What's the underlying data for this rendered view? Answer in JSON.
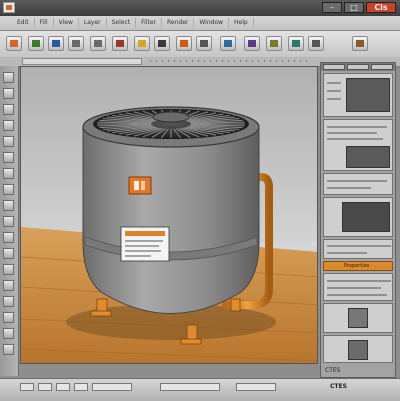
{
  "window": {
    "title": "",
    "close_label": "Cls",
    "min_label": "–",
    "max_label": "□"
  },
  "menu": {
    "items": [
      "Edit",
      "Fill",
      "View",
      "Layer",
      "Select",
      "Filter",
      "Render",
      "Window",
      "Help"
    ]
  },
  "toolbar": {
    "icons": [
      "new-file-icon",
      "open-icon",
      "save-icon",
      "undo-icon",
      "redo-icon",
      "camera-icon",
      "light-icon",
      "material-icon",
      "render-icon",
      "grid-icon",
      "move-icon",
      "rotate-icon",
      "scale-icon",
      "snap-icon",
      "zoom-icon",
      "pan-icon"
    ]
  },
  "document": {
    "tab_label": ""
  },
  "right_panel": {
    "orange_bar_label": "Properties",
    "bottom_label": "CTES"
  },
  "status": {
    "left": "",
    "right": "CTES"
  },
  "colors": {
    "accent": "#d88a2c",
    "tank": "#8c8c8c",
    "floor": "#c4873b",
    "close": "#c9432a"
  }
}
